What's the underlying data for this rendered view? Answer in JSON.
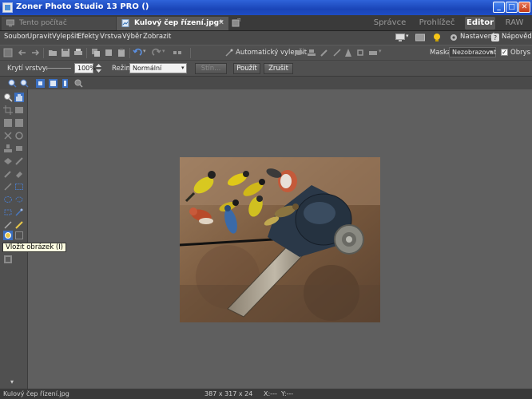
{
  "window": {
    "title": "Zoner Photo Studio 13 PRO  ()"
  },
  "tabs": [
    {
      "label": "Tento počítač",
      "active": false
    },
    {
      "label": "Kulový čep řízení.jpg*",
      "active": true
    }
  ],
  "modes": [
    "Správce",
    "Prohlížeč",
    "Editor",
    "RAW"
  ],
  "active_mode": "Editor",
  "menu": [
    "Soubor",
    "Upravit",
    "Vylepšit",
    "Efekty",
    "Vrstva",
    "Výběr",
    "Zobrazit"
  ],
  "menu_right": {
    "settings": "Nastavení",
    "help": "Nápověda"
  },
  "toolbar1": {
    "auto_enhance": "Automatický vylepšit",
    "mask_label": "Maska:",
    "mask_value": "Nezobrazovat",
    "outline_label": "Obrys"
  },
  "toolbar2": {
    "opacity_label": "Krytí vrstvy:",
    "opacity_value": "100%",
    "mode_label": "Režim:",
    "mode_value": "Normální",
    "blur_button": "Stín...",
    "apply_button": "Použít",
    "cancel_button": "Zrušit"
  },
  "tooltip": "Vložit obrázek (I)",
  "status": {
    "filename": "Kulový čep řízení.jpg",
    "dimensions": "387 x 317 x 24",
    "x": "X:---",
    "y": "Y:---"
  },
  "colors": {
    "accent": "#1d4cc4",
    "panel": "#505050",
    "canvas": "#5f5f5f"
  }
}
